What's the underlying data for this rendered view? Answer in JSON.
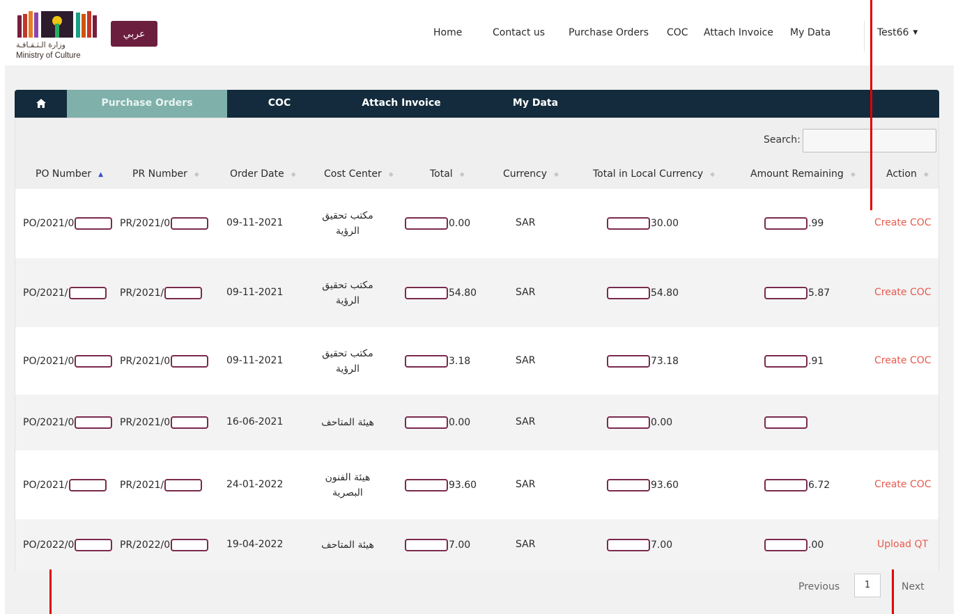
{
  "header": {
    "logo_arabic": "وزارة الـثـقـافـة",
    "logo_english": "Ministry of Culture",
    "lang_button": "عربي",
    "nav": [
      "Home",
      "Contact us",
      "Purchase Orders",
      "COC",
      "Attach Invoice",
      "My Data"
    ],
    "user": "Test66"
  },
  "subnav": {
    "items": [
      "Purchase Orders",
      "COC",
      "Attach Invoice",
      "My Data"
    ],
    "active": "Purchase Orders"
  },
  "table": {
    "search_label": "Search:",
    "columns": [
      "PO Number",
      "PR Number",
      "Order Date",
      "Cost Center",
      "Total",
      "Currency",
      "Total in Local Currency",
      "Amount Remaining",
      "Action"
    ],
    "rows": [
      {
        "po": "PO/2021/0",
        "pr": "PR/2021/0",
        "date": "09-11-2021",
        "cost_center": "مكتب تحقيق الرؤية",
        "total": "0.00",
        "currency": "SAR",
        "local": "30.00",
        "remaining": ".99",
        "action": "Create COC"
      },
      {
        "po": "PO/2021/",
        "pr": "PR/2021/",
        "date": "09-11-2021",
        "cost_center": "مكتب تحقيق الرؤية",
        "total": "54.80",
        "currency": "SAR",
        "local": "54.80",
        "remaining": "5.87",
        "action": "Create COC"
      },
      {
        "po": "PO/2021/0",
        "pr": "PR/2021/0",
        "date": "09-11-2021",
        "cost_center": "مكتب تحقيق الرؤية",
        "total": "3.18",
        "currency": "SAR",
        "local": "73.18",
        "remaining": ".91",
        "action": "Create COC"
      },
      {
        "po": "PO/2021/0",
        "pr": "PR/2021/0",
        "date": "16-06-2021",
        "cost_center": "هيئة المتاحف",
        "total": "0.00",
        "currency": "SAR",
        "local": "0.00",
        "remaining": "",
        "action": ""
      },
      {
        "po": "PO/2021/",
        "pr": "PR/2021/",
        "date": "24-01-2022",
        "cost_center": "هيئة الفنون البصرية",
        "total": "93.60",
        "currency": "SAR",
        "local": "93.60",
        "remaining": "6.72",
        "action": "Create COC"
      },
      {
        "po": "PO/2022/0",
        "pr": "PR/2022/0",
        "date": "19-04-2022",
        "cost_center": "هيئة المتاحف",
        "total": "7.00",
        "currency": "SAR",
        "local": "7.00",
        "remaining": ".00",
        "action": "Upload QT"
      }
    ]
  },
  "pagination": {
    "previous": "Previous",
    "page": "1",
    "next": "Next"
  },
  "colors": {
    "brand": "#6c1e3f",
    "nav_dark": "#132b3c",
    "active_tab": "#7fb0aa",
    "action": "#e75a4e",
    "annotation": "#e00000"
  }
}
